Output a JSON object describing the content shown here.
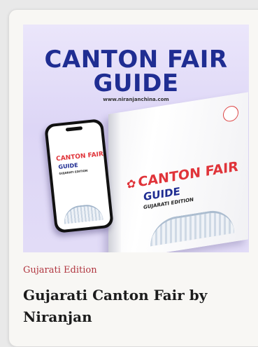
{
  "product": {
    "category": "Gujarati Edition",
    "title": "Gujarati Canton Fair by Niranjan"
  },
  "cover": {
    "title_line1": "CANTON FAIR",
    "title_line2": "GUIDE",
    "url": "www.niranjanchina.com",
    "book_title": "CANTON FAIR",
    "book_subtitle": "GUIDE",
    "book_edition": "GUJARATI EDITION",
    "phone_title": "CANTON FAIR",
    "phone_subtitle": "GUIDE",
    "phone_edition": "GUJARATI EDITION",
    "icons": {
      "logo": "flower-logo-icon"
    }
  },
  "colors": {
    "accent": "#b0353f",
    "brand_blue": "#1f2d92",
    "brand_red": "#e0343a"
  }
}
